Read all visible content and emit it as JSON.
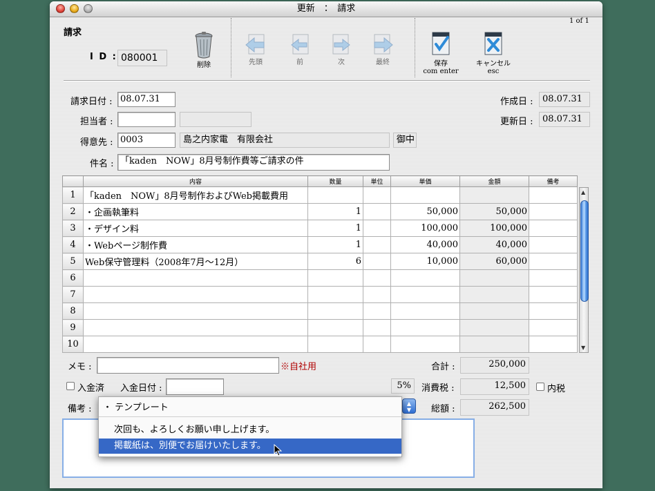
{
  "window": {
    "title": "更新　：　請求"
  },
  "header": {
    "page_info": "1 of 1",
    "form_title": "請求",
    "id_label": "I D :",
    "id_value": "080001"
  },
  "toolbar": {
    "delete_label": "削除",
    "first_label": "先頭",
    "prev_label": "前",
    "next_label": "次",
    "last_label": "最終",
    "save_label": "保存",
    "save_shortcut": "com enter",
    "cancel_label": "キャンセル",
    "cancel_shortcut": "esc"
  },
  "form": {
    "invoice_date_label": "請求日付 :",
    "invoice_date": "08.07.31",
    "person_label": "担当者 :",
    "person_value": "",
    "person_name": "",
    "client_label": "得意先 :",
    "client_code": "0003",
    "client_name": "島之内家電　有限会社",
    "honorific": "御中",
    "subject_label": "件名 :",
    "subject": "「kaden　NOW」8月号制作費等ご請求の件",
    "created_label": "作成日 :",
    "created": "08.07.31",
    "updated_label": "更新日 :",
    "updated": "08.07.31"
  },
  "table": {
    "headers": [
      "内容",
      "数量",
      "単位",
      "単価",
      "金額",
      "備考"
    ],
    "rows": [
      {
        "no": "1",
        "content": "「kaden　NOW」8月号制作およびWeb掲載費用",
        "qty": "",
        "unit": "",
        "price": "",
        "amount": "",
        "note": ""
      },
      {
        "no": "2",
        "content": "・企画執筆料",
        "qty": "1",
        "unit": "",
        "price": "50,000",
        "amount": "50,000",
        "note": ""
      },
      {
        "no": "3",
        "content": "・デザイン料",
        "qty": "1",
        "unit": "",
        "price": "100,000",
        "amount": "100,000",
        "note": ""
      },
      {
        "no": "4",
        "content": "・Webページ制作費",
        "qty": "1",
        "unit": "",
        "price": "40,000",
        "amount": "40,000",
        "note": ""
      },
      {
        "no": "5",
        "content": "Web保守管理料（2008年7月〜12月）",
        "qty": "6",
        "unit": "",
        "price": "10,000",
        "amount": "60,000",
        "note": ""
      },
      {
        "no": "6",
        "content": "",
        "qty": "",
        "unit": "",
        "price": "",
        "amount": "",
        "note": ""
      },
      {
        "no": "7",
        "content": "",
        "qty": "",
        "unit": "",
        "price": "",
        "amount": "",
        "note": ""
      },
      {
        "no": "8",
        "content": "",
        "qty": "",
        "unit": "",
        "price": "",
        "amount": "",
        "note": ""
      },
      {
        "no": "9",
        "content": "",
        "qty": "",
        "unit": "",
        "price": "",
        "amount": "",
        "note": ""
      },
      {
        "no": "10",
        "content": "",
        "qty": "",
        "unit": "",
        "price": "",
        "amount": "",
        "note": ""
      }
    ]
  },
  "footer": {
    "memo_label": "メモ :",
    "memo_value": "",
    "internal_note": "※自社用",
    "paid_label": "入金済",
    "paid_date_label": "入金日付 :",
    "paid_date": "",
    "remarks_label": "備考 :",
    "subtotal_label": "合計 :",
    "subtotal": "250,000",
    "tax_rate": "5%",
    "tax_label": "消費税 :",
    "tax": "12,500",
    "tax_included_label": "内税",
    "total_label": "総額 :",
    "total": "262,500"
  },
  "template_menu": {
    "header": "・ テンプレート",
    "items": [
      "次回も、よろしくお願い申し上げます。",
      "掲載紙は、別便でお届けいたします。"
    ],
    "selected_index": 1
  },
  "colors": {
    "accent": "#3668c6",
    "internal_note": "#b00000",
    "desktop": "#3f6d5c"
  }
}
